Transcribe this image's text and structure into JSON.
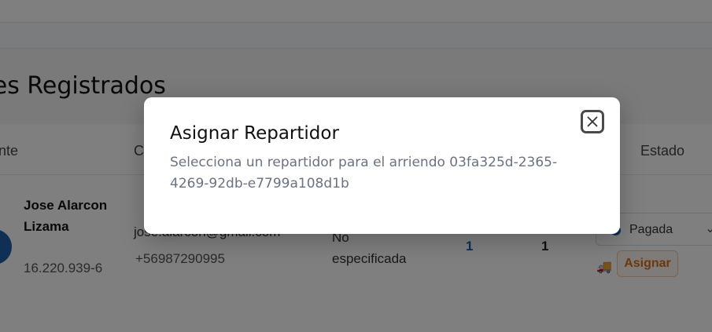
{
  "page": {
    "section_title": "ntes Registrados"
  },
  "table": {
    "headers": [
      "ente",
      "C",
      "Estado"
    ],
    "row": {
      "name": "Jose Alarcon Lizama",
      "rut": "16.220.939-6",
      "email": "jose.alarcon@gmail.com",
      "phone": "+56987290995",
      "address": "No especificada",
      "count_a": "1",
      "count_b": "1",
      "status": "Pagada",
      "assign_label": "Asignar"
    }
  },
  "modal": {
    "title": "Asignar Repartidor",
    "description": "Selecciona un repartidor para el arriendo 03fa325d-2365-4269-92db-e7799a108d1b",
    "close_icon": "close-icon"
  },
  "colors": {
    "overlay": "rgba(0,0,0,0.5)",
    "accent_blue": "#1f5fa8",
    "accent_orange": "#d9701e"
  }
}
